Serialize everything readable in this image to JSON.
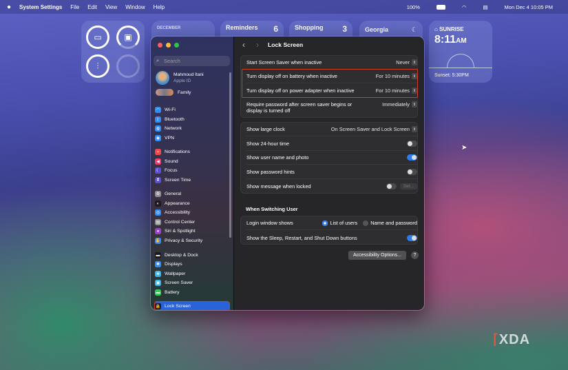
{
  "menubar": {
    "app": "System Settings",
    "menus": [
      "File",
      "Edit",
      "View",
      "Window",
      "Help"
    ],
    "battery": "100%",
    "datetime": "Mon Dec 4  10:05 PM"
  },
  "widgets": {
    "calendar_month": "DECEMBER",
    "reminders": {
      "title": "Reminders",
      "count": "6"
    },
    "shopping": {
      "title": "Shopping",
      "count": "3"
    },
    "weather": {
      "location": "Georgia"
    },
    "sunrise": {
      "label": "SUNRISE",
      "time": "8:11",
      "ampm": "AM",
      "sunset": "Sunset: 5:30PM"
    }
  },
  "sidebar": {
    "search_placeholder": "Search",
    "user": {
      "name": "Mahmoud Itani",
      "sub": "Apple ID"
    },
    "family": "Family",
    "items": [
      {
        "label": "Wi-Fi",
        "color": "#2f8df5",
        "glyph": "◠"
      },
      {
        "label": "Bluetooth",
        "color": "#2f8df5",
        "glyph": "ᛒ"
      },
      {
        "label": "Network",
        "color": "#2f8df5",
        "glyph": "◍"
      },
      {
        "label": "VPN",
        "color": "#2f8df5",
        "glyph": "◉"
      },
      {
        "label": "Notifications",
        "color": "#ef4a4a",
        "glyph": "▪"
      },
      {
        "label": "Sound",
        "color": "#ef3f68",
        "glyph": "◀"
      },
      {
        "label": "Focus",
        "color": "#5b4fd6",
        "glyph": "☾"
      },
      {
        "label": "Screen Time",
        "color": "#5b4fd6",
        "glyph": "⧗"
      },
      {
        "label": "General",
        "color": "#8e8e93",
        "glyph": "⚙"
      },
      {
        "label": "Appearance",
        "color": "#1c1c1e",
        "glyph": "◐"
      },
      {
        "label": "Accessibility",
        "color": "#2f8df5",
        "glyph": "◎"
      },
      {
        "label": "Control Center",
        "color": "#8e8e93",
        "glyph": "▤"
      },
      {
        "label": "Siri & Spotlight",
        "color": "#9b3fd0",
        "glyph": "●"
      },
      {
        "label": "Privacy & Security",
        "color": "#2f8df5",
        "glyph": "✋"
      },
      {
        "label": "Desktop & Dock",
        "color": "#1c1c1e",
        "glyph": "▬"
      },
      {
        "label": "Displays",
        "color": "#2f8df5",
        "glyph": "✺"
      },
      {
        "label": "Wallpaper",
        "color": "#39b6e8",
        "glyph": "❀"
      },
      {
        "label": "Screen Saver",
        "color": "#39b6e8",
        "glyph": "▣"
      },
      {
        "label": "Battery",
        "color": "#34c759",
        "glyph": "▬"
      },
      {
        "label": "Lock Screen",
        "color": "#1c1c1e",
        "glyph": "🔒"
      }
    ]
  },
  "content": {
    "title": "Lock Screen",
    "group1": [
      {
        "label": "Start Screen Saver when inactive",
        "value": "Never"
      },
      {
        "label": "Turn display off on battery when inactive",
        "value": "For 10 minutes"
      },
      {
        "label": "Turn display off on power adapter when inactive",
        "value": "For 10 minutes"
      },
      {
        "label": "Require password after screen saver begins or display is turned off",
        "value": "Immediately"
      }
    ],
    "group2": {
      "large_clock": {
        "label": "Show large clock",
        "value": "On Screen Saver and Lock Screen"
      },
      "toggles": [
        {
          "label": "Show 24-hour time",
          "on": false
        },
        {
          "label": "Show user name and photo",
          "on": true
        },
        {
          "label": "Show password hints",
          "on": false
        },
        {
          "label": "Show message when locked",
          "on": false
        }
      ],
      "set_button": "Set..."
    },
    "switching_header": "When Switching User",
    "group3": {
      "login_label": "Login window shows",
      "option1": "List of users",
      "option2": "Name and password",
      "selected": "List of users",
      "sleep_label": "Show the Sleep, Restart, and Shut Down buttons",
      "sleep_on": true
    },
    "accessibility_button": "Accessibility Options...",
    "help": "?"
  },
  "watermark": "XDA"
}
